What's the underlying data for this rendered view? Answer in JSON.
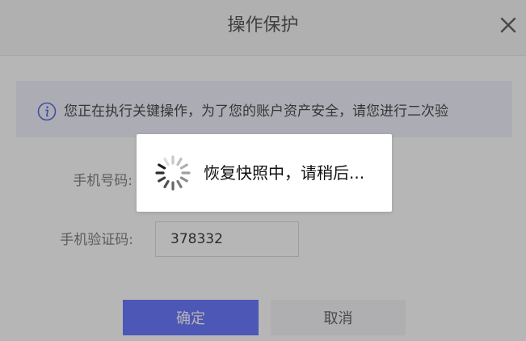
{
  "dialog": {
    "title": "操作保护",
    "close_icon": "close-icon",
    "notice": {
      "icon": "info-icon",
      "text": "您正在执行关键操作，为了您的账户资产安全，请您进行二次验"
    },
    "phone_label": "手机号码:",
    "code_label": "手机验证码:",
    "code_value": "378332",
    "confirm_label": "确定",
    "cancel_label": "取消"
  },
  "loading": {
    "icon": "spinner-icon",
    "text": "恢复快照中，请稍后..."
  },
  "colors": {
    "primary": "#4b5cff",
    "header_bg": "#f4f4f6",
    "notice_bg": "#eef0fb",
    "overlay": "rgba(80,80,80,0.42)"
  }
}
